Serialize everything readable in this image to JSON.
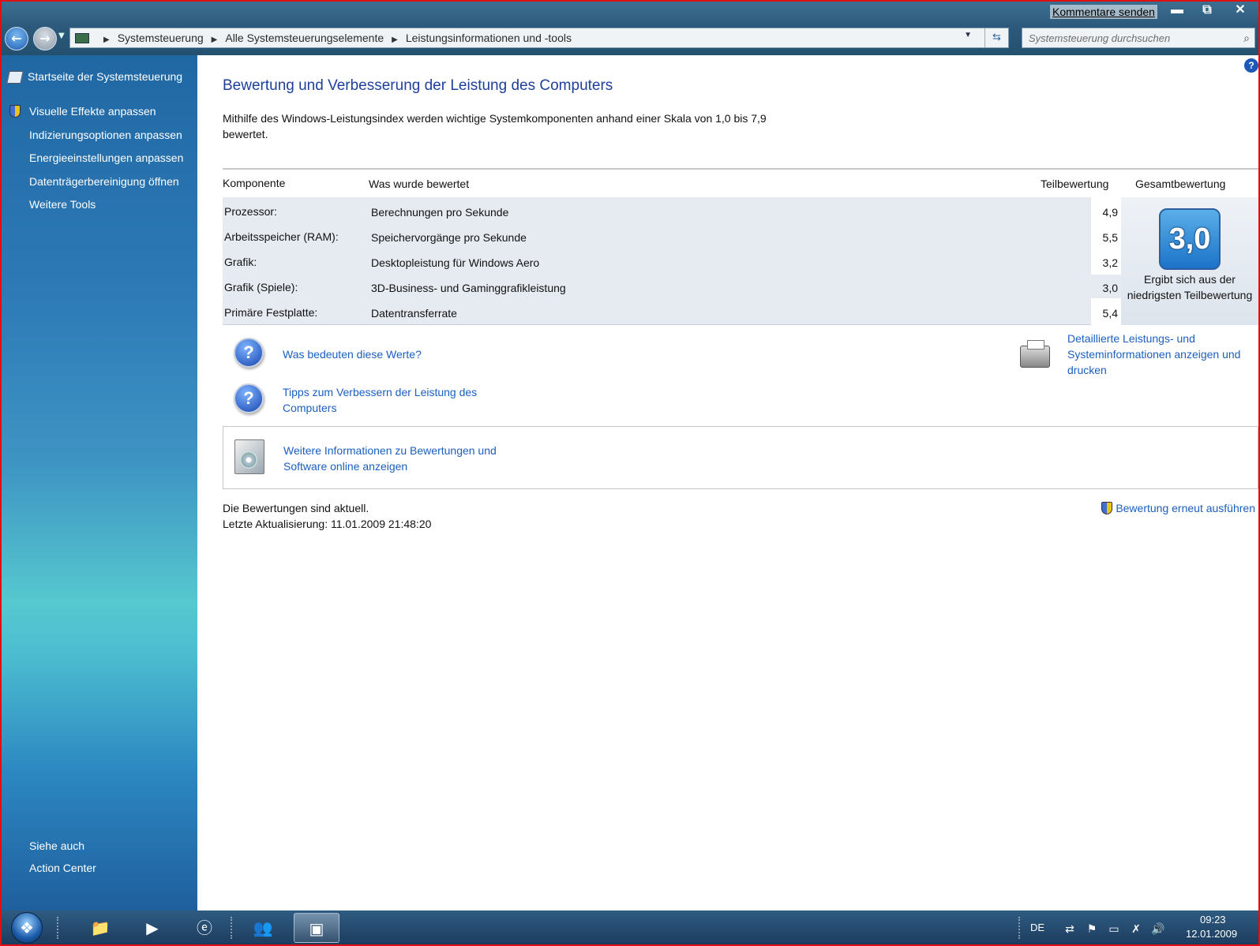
{
  "window": {
    "feedback_link": "Kommentare senden",
    "minimize_glyph": "▬",
    "maximize_glyph": "⧉",
    "close_glyph": "✕"
  },
  "address_bar": {
    "breadcrumbs": [
      "Systemsteuerung",
      "Alle Systemsteuerungselemente",
      "Leistungsinformationen und -tools"
    ],
    "search_placeholder": "Systemsteuerung durchsuchen"
  },
  "sidebar": {
    "home": "Startseite der Systemsteuerung",
    "tasks": [
      "Visuelle Effekte anpassen",
      "Indizierungsoptionen anpassen",
      "Energieeinstellungen anpassen",
      "Datenträgerbereinigung öffnen",
      "Weitere Tools"
    ],
    "see_also_heading": "Siehe auch",
    "see_also_items": [
      "Action Center"
    ]
  },
  "main": {
    "title": "Bewertung und Verbesserung der Leistung des Computers",
    "intro": "Mithilfe des Windows-Leistungsindex werden wichtige Systemkomponenten anhand einer Skala von 1,0 bis 7,9 bewertet.",
    "columns": {
      "component": "Komponente",
      "rated": "Was wurde bewertet",
      "subscore": "Teilbewertung",
      "base_score": "Gesamtbewertung"
    },
    "rows": [
      {
        "component": "Prozessor:",
        "rated": "Berechnungen pro Sekunde",
        "score": "4,9"
      },
      {
        "component": "Arbeitsspeicher (RAM):",
        "rated": "Speichervorgänge pro Sekunde",
        "score": "5,5"
      },
      {
        "component": "Grafik:",
        "rated": "Desktopleistung für Windows Aero",
        "score": "3,2"
      },
      {
        "component": "Grafik (Spiele):",
        "rated": "3D-Business- und Gaminggrafikleistung",
        "score": "3,0"
      },
      {
        "component": "Primäre Festplatte:",
        "rated": "Datentransferrate",
        "score": "5,4"
      }
    ],
    "base_score": "3,0",
    "base_score_note": "Ergibt sich aus der niedrigsten Teilbewertung",
    "links": {
      "what_mean": "Was bedeuten diese Werte?",
      "tips": "Tipps zum Verbessern der Leistung des Computers",
      "details": "Detaillierte Leistungs- und Systeminformationen anzeigen und drucken",
      "online": "Weitere Informationen zu Bewertungen und Software online anzeigen",
      "rerun": "Bewertung erneut ausführen"
    },
    "status": "Die Bewertungen sind aktuell.",
    "last_update": "Letzte Aktualisierung: 11.01.2009 21:48:20"
  },
  "taskbar": {
    "language": "DE",
    "time": "09:23",
    "date": "12.01.2009"
  }
}
